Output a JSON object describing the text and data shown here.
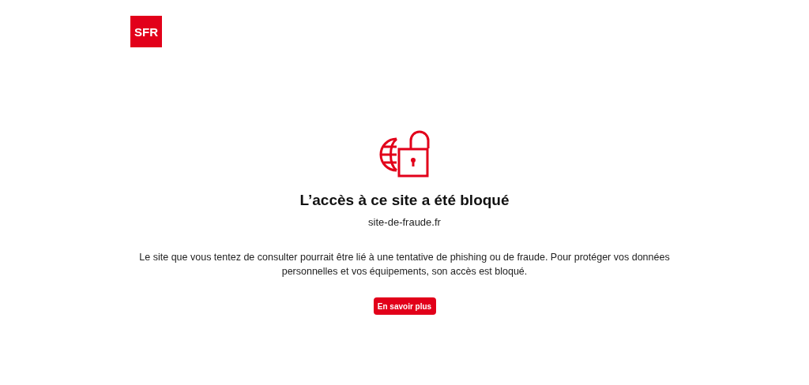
{
  "logo": {
    "text": "SFR"
  },
  "title": "L’accès à ce site a été bloqué",
  "url": "site-de-fraude.fr",
  "message": "Le site que vous tentez de consulter pourrait être lié à une tentative de phishing ou de fraude. Pour protéger vos données personnelles et vos équipements, son accès est bloqué.",
  "button": {
    "label": "En savoir plus"
  }
}
